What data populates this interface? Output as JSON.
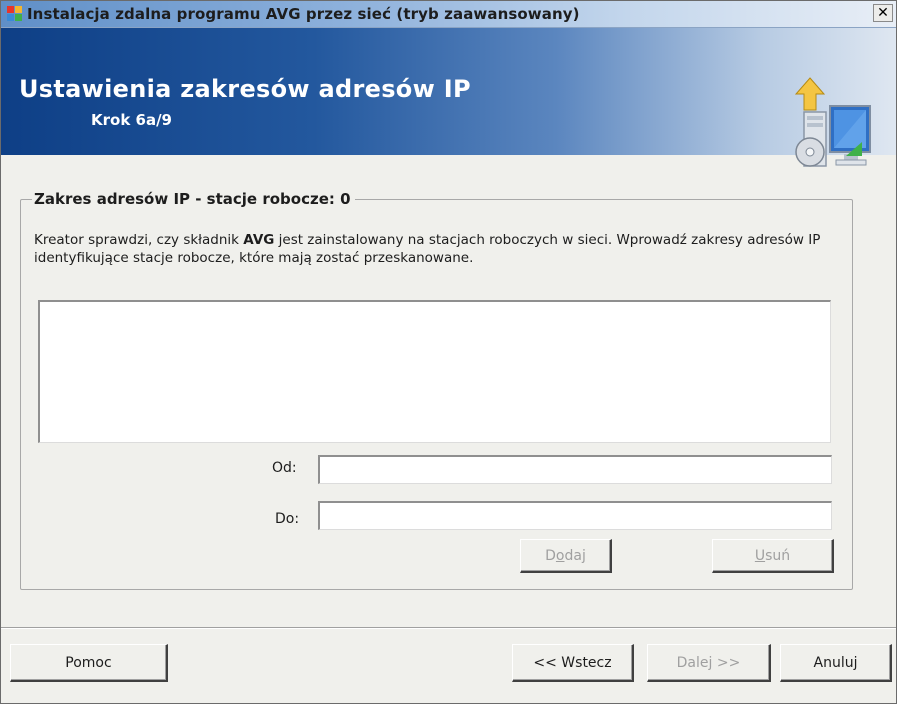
{
  "window": {
    "title": "Instalacja zdalna programu AVG przez sieć (tryb zaawansowany)",
    "close_glyph": "✕"
  },
  "banner": {
    "title": "Ustawienia zakresów adresów IP",
    "step": "Krok 6a/9",
    "icon": "computer-install-icon"
  },
  "group": {
    "legend": "Zakres adresów IP - stacje robocze: 0",
    "description_before": "Kreator sprawdzi, czy składnik ",
    "description_bold": "AVG",
    "description_after": " jest zainstalowany na stacjach roboczych w sieci. Wprowadź zakresy adresów IP identyfikujące stacje robocze, które mają zostać przeskanowane.",
    "ranges": []
  },
  "form": {
    "from_label": "Od:",
    "from_value": "",
    "to_label": "Do:",
    "to_value": "",
    "add_button": {
      "prefix": "D",
      "mnemonic": "o",
      "suffix": "daj"
    },
    "remove_button": {
      "prefix": "",
      "mnemonic": "U",
      "suffix": "suń"
    }
  },
  "footer": {
    "help": "Pomoc",
    "back": "<< Wstecz",
    "next": "Dalej >>",
    "cancel": "Anuluj"
  }
}
